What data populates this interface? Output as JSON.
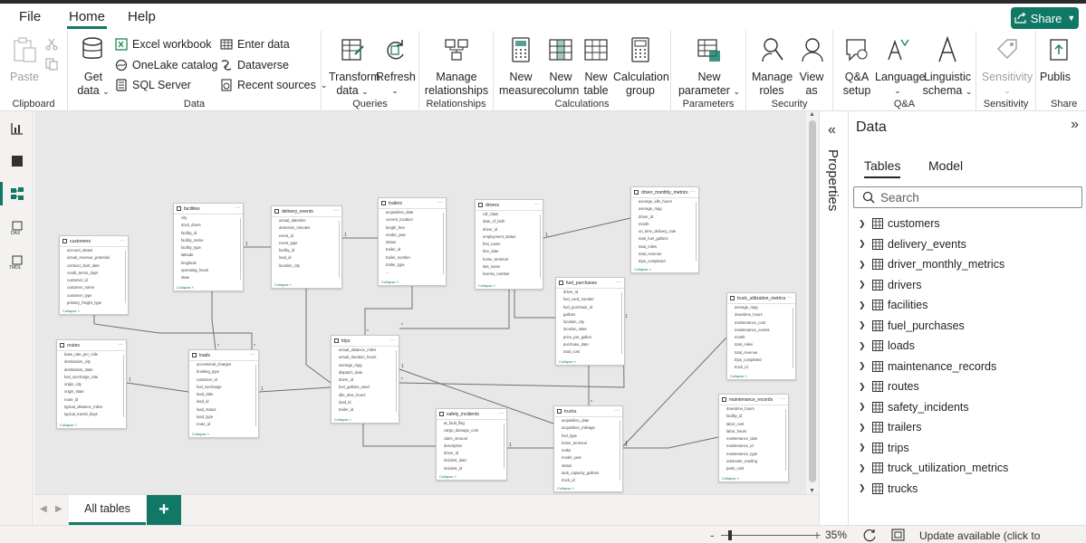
{
  "menu": {
    "file": "File",
    "home": "Home",
    "help": "Help",
    "share": "Share"
  },
  "ribbon": {
    "clipboard": {
      "label": "Clipboard",
      "paste": "Paste"
    },
    "data": {
      "label": "Data",
      "get_data_1": "Get",
      "get_data_2": "data",
      "excel": "Excel workbook",
      "onelake": "OneLake catalog",
      "sql": "SQL Server",
      "enter_data": "Enter data",
      "dataverse": "Dataverse",
      "recent": "Recent sources"
    },
    "queries": {
      "label": "Queries",
      "transform_1": "Transform",
      "transform_2": "data",
      "refresh": "Refresh"
    },
    "relationships": {
      "label": "Relationships",
      "manage_1": "Manage",
      "manage_2": "relationships"
    },
    "calculations": {
      "label": "Calculations",
      "new_measure_1": "New",
      "new_measure_2": "measure",
      "new_column_1": "New",
      "new_column_2": "column",
      "new_table_1": "New",
      "new_table_2": "table",
      "calc_group_1": "Calculation",
      "calc_group_2": "group"
    },
    "parameters": {
      "label": "Parameters",
      "new_param_1": "New",
      "new_param_2": "parameter"
    },
    "security": {
      "label": "Security",
      "manage_roles_1": "Manage",
      "manage_roles_2": "roles",
      "view_as_1": "View",
      "view_as_2": "as"
    },
    "qa": {
      "label": "Q&A",
      "setup_1": "Q&A",
      "setup_2": "setup",
      "language": "Language",
      "ling_1": "Linguistic",
      "ling_2": "schema"
    },
    "sensitivity": {
      "label": "Sensitivity",
      "btn": "Sensitivity"
    },
    "share": {
      "label": "Share",
      "publish": "Publis"
    }
  },
  "canvas": {
    "tables": [
      {
        "name": "customers",
        "fields": [
          "account_status",
          "actual_revenue_potential",
          "contract_start_date",
          "credit_terms_days",
          "customer_id",
          "customer_name",
          "customer_type",
          "primary_freight_type"
        ]
      },
      {
        "name": "facilities",
        "fields": [
          "city",
          "dock_doors",
          "facility_id",
          "facility_name",
          "facility_type",
          "latitude",
          "longitude",
          "operating_hours",
          "state"
        ]
      },
      {
        "name": "delivery_events",
        "fields": [
          "actual_datetime",
          "detention_minutes",
          "event_id",
          "event_type",
          "facility_id",
          "load_id",
          "location_city"
        ]
      },
      {
        "name": "trailers",
        "fields": [
          "acquisition_date",
          "current_location",
          "length_feet",
          "model_year",
          "status",
          "trailer_id",
          "trailer_number",
          "trailer_type",
          "..."
        ]
      },
      {
        "name": "drivers",
        "fields": [
          "cdl_class",
          "date_of_birth",
          "driver_id",
          "employment_status",
          "first_name",
          "hire_date",
          "home_terminal",
          "last_name",
          "license_number"
        ]
      },
      {
        "name": "driver_monthly_metrics",
        "fields": [
          "average_idle_hours",
          "average_mpg",
          "driver_id",
          "month",
          "on_time_delivery_rate",
          "total_fuel_gallons",
          "total_miles",
          "total_revenue",
          "trips_completed"
        ]
      },
      {
        "name": "routes",
        "fields": [
          "base_rate_per_mile",
          "destination_city",
          "destination_state",
          "fuel_surcharge_rate",
          "origin_city",
          "origin_state",
          "route_id",
          "typical_distance_miles",
          "typical_transit_days"
        ]
      },
      {
        "name": "loads",
        "fields": [
          "accessorial_charges",
          "booking_type",
          "customer_id",
          "fuel_surcharge",
          "load_date",
          "load_id",
          "load_status",
          "load_type",
          "route_id"
        ]
      },
      {
        "name": "trips",
        "fields": [
          "actual_distance_miles",
          "actual_duration_hours",
          "average_mpg",
          "dispatch_date",
          "driver_id",
          "fuel_gallons_used",
          "idle_time_hours",
          "load_id",
          "trailer_id"
        ]
      },
      {
        "name": "fuel_purchases",
        "fields": [
          "driver_id",
          "fuel_card_number",
          "fuel_purchase_id",
          "gallons",
          "location_city",
          "location_state",
          "price_per_gallon",
          "purchase_date",
          "total_cost"
        ]
      },
      {
        "name": "truck_utilization_metrics",
        "fields": [
          "average_mpg",
          "downtime_hours",
          "maintenance_cost",
          "maintenance_events",
          "month",
          "total_miles",
          "total_revenue",
          "trips_completed",
          "truck_id"
        ]
      },
      {
        "name": "safety_incidents",
        "fields": [
          "at_fault_flag",
          "cargo_damage_cost",
          "claim_amount",
          "description",
          "driver_id",
          "incident_date",
          "incident_id"
        ]
      },
      {
        "name": "trucks",
        "fields": [
          "acquisition_date",
          "acquisition_mileage",
          "fuel_type",
          "home_terminal",
          "make",
          "model_year",
          "status",
          "tank_capacity_gallons",
          "truck_id"
        ]
      },
      {
        "name": "maintenance_records",
        "fields": [
          "downtime_hours",
          "facility_id",
          "labor_cost",
          "labor_hours",
          "maintenance_date",
          "maintenance_id",
          "maintenance_type",
          "odometer_reading",
          "parts_cost"
        ]
      }
    ],
    "collapse": "Collapse",
    "cardinality_one": "1",
    "cardinality_many": "*"
  },
  "page_tabs": {
    "active": "All tables",
    "add": "+"
  },
  "status": {
    "zoom": "35%",
    "minus": "-",
    "plus": "+",
    "update": "Update available (click to download)"
  },
  "properties": {
    "label": "Properties"
  },
  "data_pane": {
    "title": "Data",
    "tab_tables": "Tables",
    "tab_model": "Model",
    "search_placeholder": "Search",
    "tables": [
      "customers",
      "delivery_events",
      "driver_monthly_metrics",
      "drivers",
      "facilities",
      "fuel_purchases",
      "loads",
      "maintenance_records",
      "routes",
      "safety_incidents",
      "trailers",
      "trips",
      "truck_utilization_metrics",
      "trucks"
    ]
  },
  "colors": {
    "accent": "#117865",
    "canvas": "#e8e8e8"
  }
}
